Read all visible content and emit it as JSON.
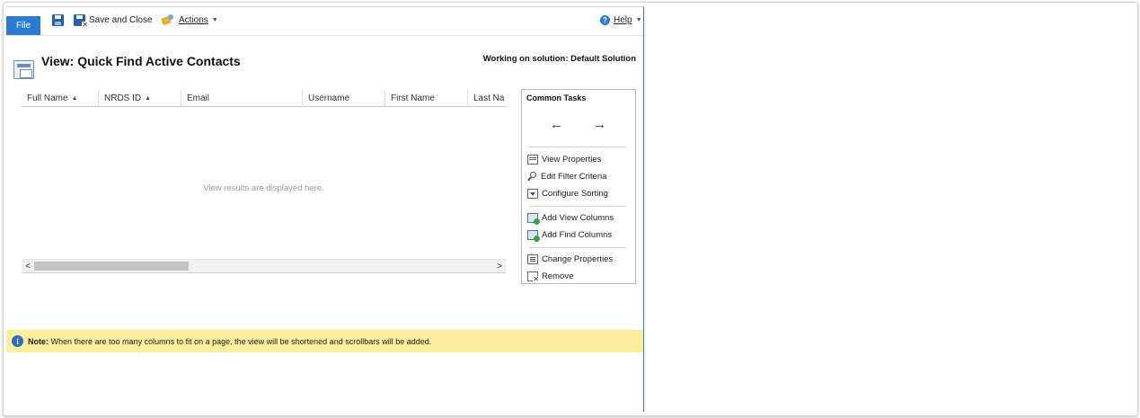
{
  "ribbon": {
    "file_label": "File",
    "save_and_close_label": "Save and Close",
    "actions_label": "Actions",
    "help_label": "Help"
  },
  "page": {
    "title": "View: Quick Find Active Contacts",
    "solution_text": "Working on solution: Default Solution"
  },
  "grid": {
    "columns": [
      {
        "label": "Full Name",
        "sorted": true
      },
      {
        "label": "NRDS ID",
        "sorted": true
      },
      {
        "label": "Email",
        "sorted": false
      },
      {
        "label": "Username",
        "sorted": false
      },
      {
        "label": "First Name",
        "sorted": false
      },
      {
        "label": "Last Na",
        "sorted": false
      }
    ],
    "empty_text": "View results are displayed here."
  },
  "common_tasks": {
    "title": "Common Tasks",
    "items": [
      {
        "label": "View Properties",
        "icon": "view-properties-icon"
      },
      {
        "label": "Edit Filter Criteria",
        "icon": "edit-filter-icon"
      },
      {
        "label": "Configure Sorting",
        "icon": "sort-icon"
      },
      {
        "label": "Add View Columns",
        "icon": "add-view-columns-icon"
      },
      {
        "label": "Add Find Columns",
        "icon": "add-find-columns-icon"
      },
      {
        "label": "Change Properties",
        "icon": "change-properties-icon"
      },
      {
        "label": "Remove",
        "icon": "remove-icon"
      }
    ]
  },
  "note": {
    "label": "Note:",
    "text": "When there are too many columns to fit on a page, the view will be shortened and scrollbars will be added."
  },
  "colors": {
    "accent": "#2b7bd0",
    "note_bg": "#fbee9d"
  }
}
